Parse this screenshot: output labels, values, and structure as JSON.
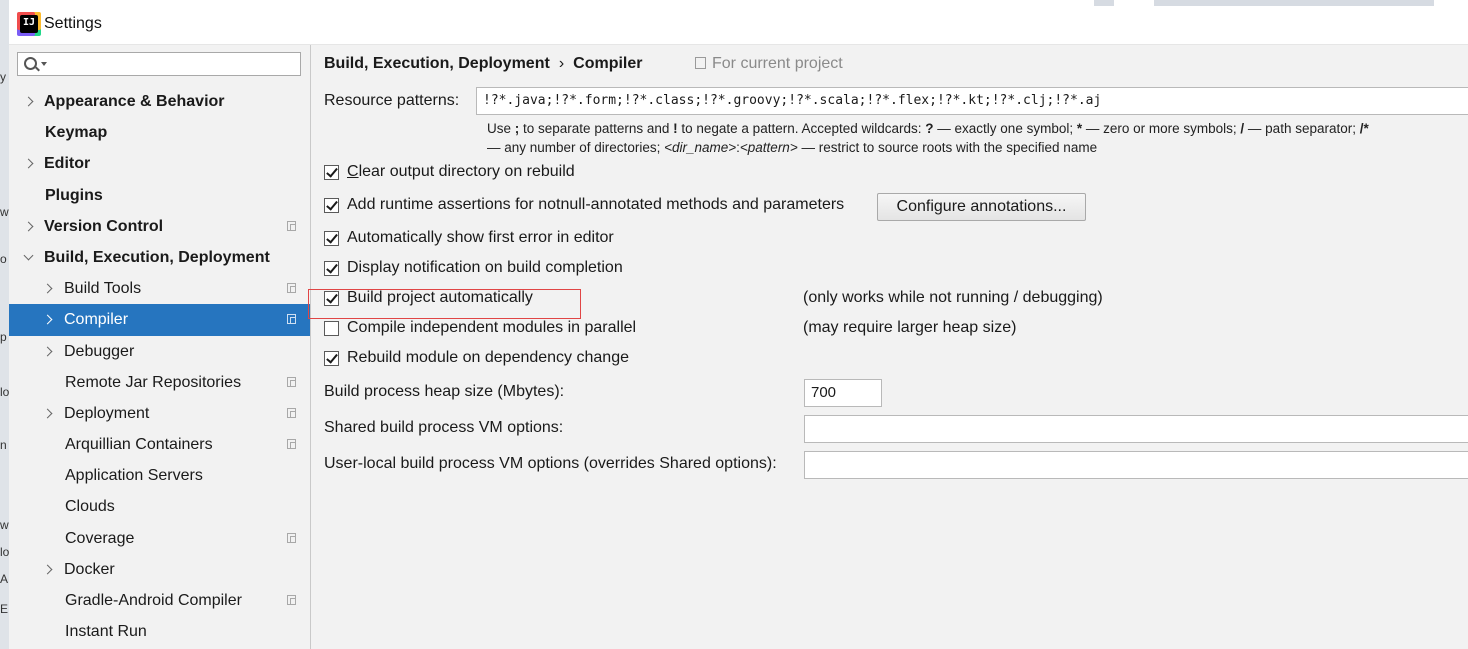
{
  "window": {
    "title": "Settings"
  },
  "search": {
    "placeholder": ""
  },
  "sidebar": {
    "items": [
      {
        "label": "Appearance & Behavior",
        "level": 0,
        "arrow": "collapsed",
        "bold": true,
        "project": false
      },
      {
        "label": "Keymap",
        "level": 0,
        "arrow": "none",
        "bold": true,
        "project": false
      },
      {
        "label": "Editor",
        "level": 0,
        "arrow": "collapsed",
        "bold": true,
        "project": false
      },
      {
        "label": "Plugins",
        "level": 0,
        "arrow": "none",
        "bold": true,
        "project": false
      },
      {
        "label": "Version Control",
        "level": 0,
        "arrow": "collapsed",
        "bold": true,
        "project": true
      },
      {
        "label": "Build, Execution, Deployment",
        "level": 0,
        "arrow": "expanded",
        "bold": true,
        "project": false
      },
      {
        "label": "Build Tools",
        "level": 1,
        "arrow": "collapsed",
        "bold": false,
        "project": true
      },
      {
        "label": "Compiler",
        "level": 1,
        "arrow": "collapsed",
        "bold": false,
        "project": true,
        "selected": true
      },
      {
        "label": "Debugger",
        "level": 1,
        "arrow": "collapsed",
        "bold": false,
        "project": false
      },
      {
        "label": "Remote Jar Repositories",
        "level": 1,
        "arrow": "none",
        "bold": false,
        "project": true
      },
      {
        "label": "Deployment",
        "level": 1,
        "arrow": "collapsed",
        "bold": false,
        "project": true
      },
      {
        "label": "Arquillian Containers",
        "level": 1,
        "arrow": "none",
        "bold": false,
        "project": true
      },
      {
        "label": "Application Servers",
        "level": 1,
        "arrow": "none",
        "bold": false,
        "project": false
      },
      {
        "label": "Clouds",
        "level": 1,
        "arrow": "none",
        "bold": false,
        "project": false
      },
      {
        "label": "Coverage",
        "level": 1,
        "arrow": "none",
        "bold": false,
        "project": true
      },
      {
        "label": "Docker",
        "level": 1,
        "arrow": "collapsed",
        "bold": false,
        "project": false
      },
      {
        "label": "Gradle-Android Compiler",
        "level": 1,
        "arrow": "none",
        "bold": false,
        "project": true
      },
      {
        "label": "Instant Run",
        "level": 1,
        "arrow": "none",
        "bold": false,
        "project": false
      }
    ]
  },
  "breadcrumb": {
    "parent": "Build, Execution, Deployment",
    "separator": "›",
    "current": "Compiler"
  },
  "scope": {
    "label": "For current project"
  },
  "resource_patterns": {
    "label": "Resource patterns:",
    "value": "!?*.java;!?*.form;!?*.class;!?*.groovy;!?*.scala;!?*.flex;!?*.kt;!?*.clj;!?*.aj",
    "hint_line1": [
      "Use ",
      "; ",
      "to separate patterns and ",
      "! ",
      "to negate a pattern. Accepted wildcards: ",
      "? ",
      "— exactly one symbol; ",
      "* ",
      "— zero or more symbols; ",
      "/ ",
      "— path separator; ",
      "/*"
    ],
    "hint_line2": [
      "— any number of directories; ",
      "<dir_name>",
      ":",
      "<pattern>",
      " — restrict to source roots with the specified name"
    ]
  },
  "options": {
    "clear_output": {
      "label": "Clear output directory on rebuild",
      "checked": true
    },
    "runtime_assertions": {
      "label": "Add runtime assertions for notnull-annotated methods and parameters",
      "checked": true
    },
    "configure_annotations": "Configure annotations...",
    "show_first_error": {
      "label": "Automatically show first error in editor",
      "checked": true
    },
    "display_notification": {
      "label": "Display notification on build completion",
      "checked": true
    },
    "build_automatically": {
      "label": "Build project automatically",
      "checked": true,
      "note": "(only works while not running / debugging)"
    },
    "compile_parallel": {
      "label": "Compile independent modules in parallel",
      "checked": false,
      "note": "(may require larger heap size)"
    },
    "rebuild_on_dependency": {
      "label": "Rebuild module on dependency change",
      "checked": true
    }
  },
  "heap_size": {
    "label": "Build process heap size (Mbytes):",
    "value": "700"
  },
  "shared_vm": {
    "label": "Shared build process VM options:",
    "value": ""
  },
  "user_local_vm": {
    "label": "User-local build process VM options (overrides Shared options):",
    "value": ""
  },
  "colors": {
    "selection": "#2675bf",
    "highlight_border": "#e04545"
  }
}
